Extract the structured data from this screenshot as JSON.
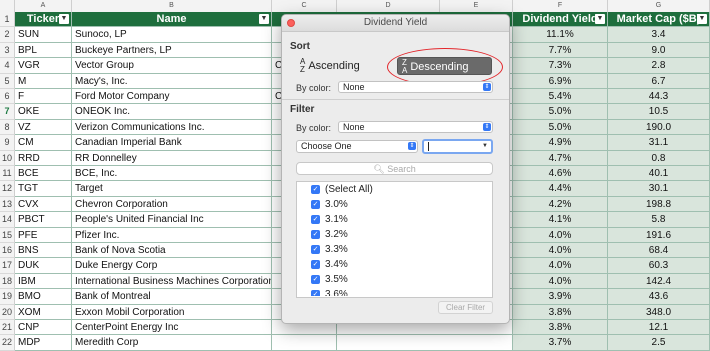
{
  "column_letters": [
    "A",
    "B",
    "C",
    "D",
    "E",
    "F",
    "G"
  ],
  "headers": {
    "ticker": "Ticker",
    "name": "Name",
    "dividend_yield": "Dividend Yield",
    "market_cap": "Market Cap ($B)"
  },
  "rows": [
    {
      "num": "1"
    },
    {
      "num": "2",
      "ticker": "SUN",
      "name": "Sunoco, LP",
      "c": "",
      "yield": "11.1%",
      "cap": "3.4"
    },
    {
      "num": "3",
      "ticker": "BPL",
      "name": "Buckeye Partners, LP",
      "c": "",
      "yield": "7.7%",
      "cap": "9.0"
    },
    {
      "num": "4",
      "ticker": "VGR",
      "name": "Vector Group",
      "c": "C",
      "yield": "7.3%",
      "cap": "2.8"
    },
    {
      "num": "5",
      "ticker": "M",
      "name": "Macy's, Inc.",
      "c": "",
      "yield": "6.9%",
      "cap": "6.7"
    },
    {
      "num": "6",
      "ticker": "F",
      "name": "Ford Motor Company",
      "c": "C",
      "yield": "5.4%",
      "cap": "44.3"
    },
    {
      "num": "7",
      "ticker": "OKE",
      "name": "ONEOK Inc.",
      "c": "",
      "yield": "5.0%",
      "cap": "10.5"
    },
    {
      "num": "8",
      "ticker": "VZ",
      "name": "Verizon Communications Inc.",
      "c": "",
      "yield": "5.0%",
      "cap": "190.0"
    },
    {
      "num": "9",
      "ticker": "CM",
      "name": "Canadian Imperial Bank",
      "c": "",
      "yield": "4.9%",
      "cap": "31.1"
    },
    {
      "num": "10",
      "ticker": "RRD",
      "name": "RR Donnelley",
      "c": "",
      "yield": "4.7%",
      "cap": "0.8"
    },
    {
      "num": "11",
      "ticker": "BCE",
      "name": "BCE, Inc.",
      "c": "",
      "yield": "4.6%",
      "cap": "40.1"
    },
    {
      "num": "12",
      "ticker": "TGT",
      "name": "Target",
      "c": "",
      "yield": "4.4%",
      "cap": "30.1"
    },
    {
      "num": "13",
      "ticker": "CVX",
      "name": "Chevron Corporation",
      "c": "",
      "yield": "4.2%",
      "cap": "198.8"
    },
    {
      "num": "14",
      "ticker": "PBCT",
      "name": "People's United Financial Inc",
      "c": "",
      "yield": "4.1%",
      "cap": "5.8"
    },
    {
      "num": "15",
      "ticker": "PFE",
      "name": "Pfizer Inc.",
      "c": "",
      "yield": "4.0%",
      "cap": "191.6"
    },
    {
      "num": "16",
      "ticker": "BNS",
      "name": "Bank of Nova Scotia",
      "c": "",
      "yield": "4.0%",
      "cap": "68.4"
    },
    {
      "num": "17",
      "ticker": "DUK",
      "name": "Duke Energy Corp",
      "c": "",
      "yield": "4.0%",
      "cap": "60.3"
    },
    {
      "num": "18",
      "ticker": "IBM",
      "name": "International Business Machines Corporation",
      "c": "",
      "yield": "4.0%",
      "cap": "142.4"
    },
    {
      "num": "19",
      "ticker": "BMO",
      "name": "Bank of Montreal",
      "c": "",
      "yield": "3.9%",
      "cap": "43.6"
    },
    {
      "num": "20",
      "ticker": "XOM",
      "name": "Exxon Mobil Corporation",
      "c": "",
      "yield": "3.8%",
      "cap": "348.0"
    },
    {
      "num": "21",
      "ticker": "CNP",
      "name": "CenterPoint Energy Inc",
      "c": "",
      "yield": "3.8%",
      "cap": "12.1"
    },
    {
      "num": "22",
      "ticker": "MDP",
      "name": "Meredith Corp",
      "c": "",
      "yield": "3.7%",
      "cap": "2.5"
    }
  ],
  "dialog": {
    "title": "Dividend Yield",
    "sort_label": "Sort",
    "ascending": "Ascending",
    "descending": "Descending",
    "by_color_label": "By color:",
    "sort_color_value": "None",
    "filter_label": "Filter",
    "filter_color_value": "None",
    "choose_one": "Choose One",
    "criteria_value": "",
    "search_placeholder": "Search",
    "values": [
      "(Select All)",
      "3.0%",
      "3.1%",
      "3.2%",
      "3.3%",
      "3.4%",
      "3.5%",
      "3.6%"
    ],
    "clear_filter": "Clear Filter"
  },
  "colors": {
    "header_green": "#1e6e3d",
    "row_green": "#d9e5dc",
    "accent_blue": "#3478f6",
    "highlight_red": "#e3262b"
  }
}
